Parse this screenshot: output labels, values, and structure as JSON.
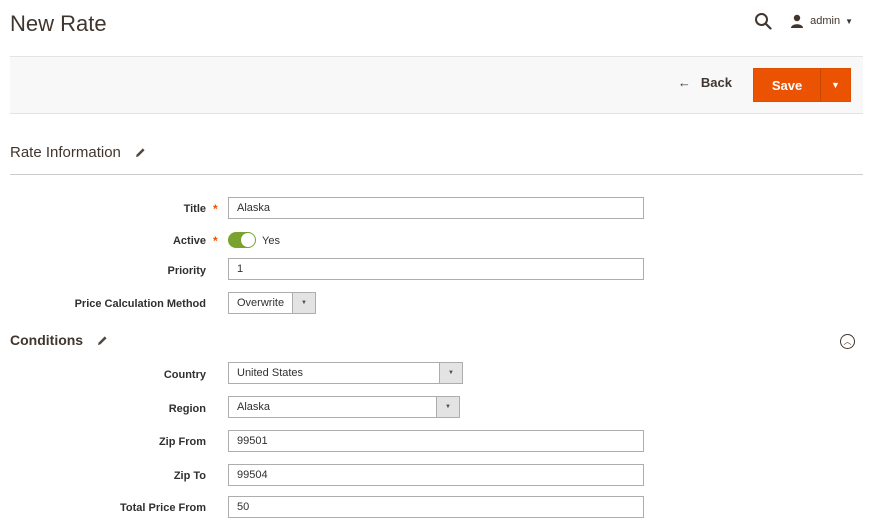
{
  "header": {
    "page_title": "New Rate",
    "user_label": "admin",
    "search_icon": "search-icon",
    "user_icon": "user-icon"
  },
  "actions": {
    "back_label": "Back",
    "save_label": "Save"
  },
  "rate_information": {
    "section_title": "Rate Information",
    "title_label": "Title",
    "title_value": "Alaska",
    "active_label": "Active",
    "active_value": "Yes",
    "priority_label": "Priority",
    "priority_value": "1",
    "price_method_label": "Price Calculation Method",
    "price_method_value": "Overwrite"
  },
  "conditions": {
    "section_title": "Conditions",
    "country_label": "Country",
    "country_value": "United States",
    "region_label": "Region",
    "region_value": "Alaska",
    "zip_from_label": "Zip From",
    "zip_from_value": "99501",
    "zip_to_label": "Zip To",
    "zip_to_value": "99504",
    "total_price_from_label": "Total Price From",
    "total_price_from_value": "50"
  },
  "colors": {
    "accent": "#eb5202",
    "toggle_on": "#79a22e",
    "text_dark": "#41362f"
  }
}
